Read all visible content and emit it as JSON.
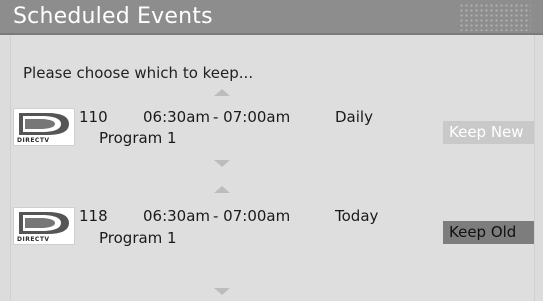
{
  "window": {
    "title": "Scheduled Events"
  },
  "prompt": "Please choose which to keep...",
  "events": [
    {
      "logo_text": "DIRECTV",
      "channel": "110",
      "start": "06:30am",
      "end": "- 07:00am",
      "repeat": "Daily",
      "program": "Program 1"
    },
    {
      "logo_text": "DIRECTV",
      "channel": "118",
      "start": "06:30am",
      "end": "- 07:00am",
      "repeat": "Today",
      "program": "Program 1"
    }
  ],
  "buttons": {
    "keep_new": "Keep New",
    "keep_old": "Keep Old"
  },
  "icons": {
    "scroll_up": "chevron-up-icon",
    "scroll_down": "chevron-down-icon",
    "logo": "directv-logo-icon"
  }
}
